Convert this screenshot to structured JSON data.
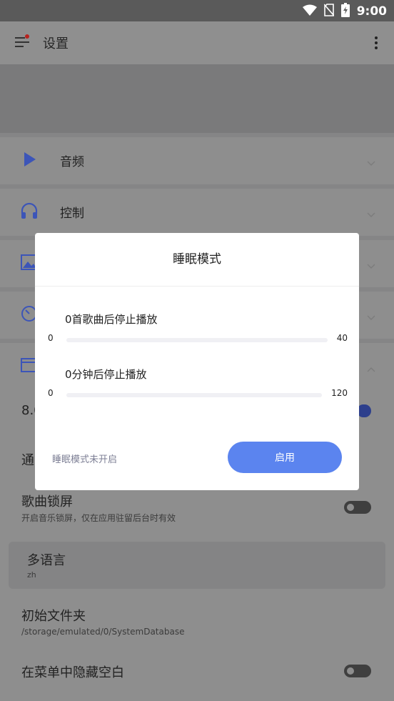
{
  "status_bar": {
    "time": "9:00",
    "icons": [
      "wifi-icon",
      "no-sim-icon",
      "battery-charging-icon"
    ]
  },
  "app_bar": {
    "title": "设置",
    "menu_icon": "menu-with-badge-icon",
    "more_icon": "more-vertical-icon"
  },
  "settings_groups": [
    {
      "label": "音频",
      "icon": "play-icon"
    },
    {
      "label": "控制",
      "icon": "headphones-icon"
    },
    {
      "label": "",
      "icon": "image-icon"
    },
    {
      "label": "",
      "icon": "timer-icon"
    },
    {
      "label": "",
      "icon": "window-icon"
    }
  ],
  "partial_texts": {
    "version_prefix": "8.0",
    "notify_prefix": "通"
  },
  "rows": {
    "lockscreen": {
      "title": "歌曲锁屏",
      "subtitle": "开启音乐锁屏，仅在应用驻留后台时有效"
    },
    "language": {
      "title": "多语言",
      "value": "zh"
    },
    "initial_folder": {
      "title": "初始文件夹",
      "value": "/storage/emulated/0/SystemDatabase"
    },
    "hide_blank": {
      "title": "在菜单中隐藏空白"
    }
  },
  "dialog": {
    "title": "睡眠模式",
    "songs_slider": {
      "caption": "0首歌曲后停止播放",
      "min": "0",
      "max": "40",
      "value": 0
    },
    "minutes_slider": {
      "caption": "0分钟后停止播放",
      "min": "0",
      "max": "120",
      "value": 0
    },
    "status": "睡眠模式未开启",
    "enable_button": "启用"
  },
  "colors": {
    "accent": "#5b84ef",
    "icon_blue": "#3c55b8"
  }
}
